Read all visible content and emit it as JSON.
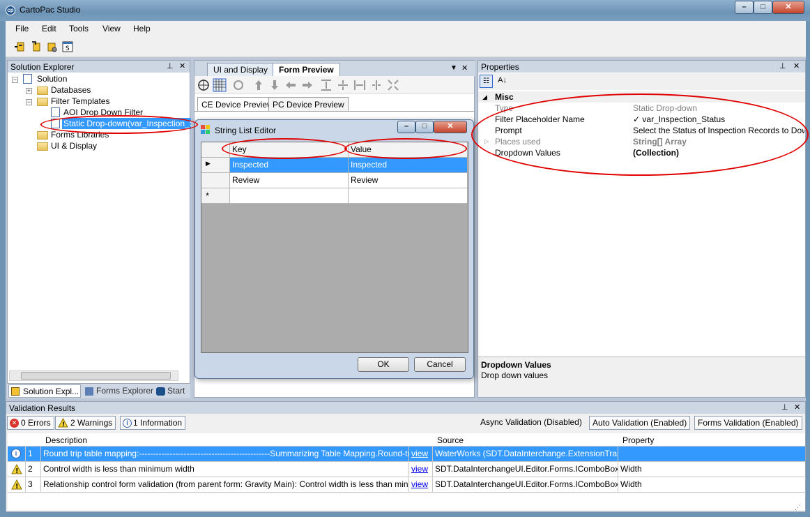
{
  "window": {
    "title": "CartoPac Studio",
    "minimize": "–",
    "maximize": "□",
    "close": "✕"
  },
  "menu": [
    "File",
    "Edit",
    "Tools",
    "View",
    "Help"
  ],
  "toolbar_icons": [
    "connect-icon",
    "publish-icon",
    "settings-icon",
    "script-icon"
  ],
  "solution_explorer": {
    "title": "Solution Explorer",
    "pin": "⊥",
    "close": "✕",
    "tree": {
      "root": "Solution",
      "databases": "Databases",
      "filter_templates": "Filter Templates",
      "aoi": "AOI Drop Down Filter",
      "static": "Static Drop-down(var_Inspection_Stat",
      "forms_libraries": "Forms Libraries",
      "ui_display": "UI & Display"
    },
    "tabs": [
      "Solution Expl...",
      "Forms Explorer",
      "Start"
    ]
  },
  "center": {
    "tabs": [
      "UI and Display",
      "Form Preview"
    ],
    "subtabs": [
      "CE Device Preview",
      "PC Device Preview"
    ]
  },
  "dialog": {
    "title": "String List Editor",
    "columns": [
      "Key",
      "Value"
    ],
    "rows": [
      {
        "key": "Inspected",
        "value": "Inspected"
      },
      {
        "key": "Review",
        "value": "Review"
      }
    ],
    "new_row_marker": "*",
    "current_row_marker": "▶",
    "ok": "OK",
    "cancel": "Cancel"
  },
  "properties": {
    "title": "Properties",
    "category": "Misc",
    "rows": [
      {
        "name": "Type",
        "value": "Static Drop-down"
      },
      {
        "name": "Filter Placeholder Name",
        "value": "✓ var_Inspection_Status"
      },
      {
        "name": "Prompt",
        "value": "Select the Status of Inspection Records to Downloa"
      },
      {
        "name": "Places used",
        "value": "String[] Array"
      },
      {
        "name": "Dropdown Values",
        "value": "(Collection)"
      }
    ],
    "desc_title": "Dropdown Values",
    "desc_text": "Drop down values"
  },
  "validation": {
    "title": "Validation Results",
    "errors": "0 Errors",
    "warnings": "2 Warnings",
    "info": "1 Information",
    "async": "Async Validation (Disabled)",
    "auto": "Auto Validation (Enabled)",
    "forms": "Forms Validation (Enabled)",
    "headers": [
      "Description",
      "Source",
      "Property"
    ],
    "rows": [
      {
        "num": "1",
        "type": "info",
        "desc": "Round trip table mapping:-----------------------------------------------Summarizing Table Mapping.Round-trip Tables:[Sour...",
        "link": "view",
        "source": "WaterWorks (SDT.DataInterchange.ExtensionTrans...",
        "property": ""
      },
      {
        "num": "2",
        "type": "warning",
        "desc": "Control width is less than minimum width",
        "link": "view",
        "source": "SDT.DataInterchangeUI.Editor.Forms.IComboBoxCo...",
        "property": "Width"
      },
      {
        "num": "3",
        "type": "warning",
        "desc": "Relationship control form validation (from parent form: Gravity Main): Control width is less than minimum width",
        "link": "view",
        "source": "SDT.DataInterchangeUI.Editor.Forms.IComboBoxCo...",
        "property": "Width"
      }
    ]
  },
  "colors": {
    "selection": "#3399ff",
    "annotation": "#e00000"
  }
}
